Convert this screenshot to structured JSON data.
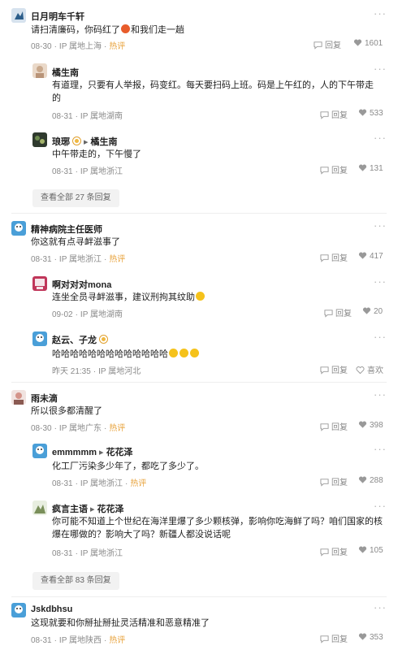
{
  "comments": [
    {
      "name": "日月明车千轩",
      "text_before": "请扫清廉码，你码红了",
      "text_after": "和我们走一趟",
      "date": "08-30",
      "ip": "IP 属地上海",
      "hot": "热评",
      "reply": "回复",
      "likes": "1601"
    },
    {
      "name": "橘生南",
      "text": "有道理，只要有人举报，码变红。每天要扫码上班。码是上午红的，人的下午带走的",
      "date": "08-31",
      "ip": "IP 属地湖南",
      "reply": "回复",
      "likes": "533"
    },
    {
      "name": "琅琊",
      "arrow": "▸",
      "reply_to": "橘生南",
      "text": "中午带走的，下午慢了",
      "date": "08-31",
      "ip": "IP 属地浙江",
      "reply": "回复",
      "likes": "131"
    },
    {
      "name": "精神病院主任医师",
      "text": "你这就有点寻衅滋事了",
      "date": "08-31",
      "ip": "IP 属地浙江",
      "hot": "热评",
      "reply": "回复",
      "likes": "417"
    },
    {
      "name": "啊对对对mona",
      "text": "连坐全员寻衅滋事，建议刑拘其纹助",
      "date": "09-02",
      "ip": "IP 属地湖南",
      "reply": "回复",
      "likes": "20"
    },
    {
      "name": "赵云、子龙",
      "text": "哈哈哈哈哈哈哈哈哈哈哈哈哈",
      "date": "昨天 21:35",
      "ip": "IP 属地河北",
      "reply": "回复",
      "likes": "喜欢"
    },
    {
      "name": "雨未滴",
      "text": "所以很多都清醒了",
      "date": "08-30",
      "ip": "IP 属地广东",
      "hot": "热评",
      "reply": "回复",
      "likes": "398"
    },
    {
      "name": "emmmmm",
      "arrow": "▸",
      "reply_to": "花花泽",
      "text": "化工厂污染多少年了，都吃了多少了。",
      "date": "08-31",
      "ip": "IP 属地浙江",
      "hot": "热评",
      "reply": "回复",
      "likes": "288"
    },
    {
      "name": "疯言主语",
      "arrow": "▸",
      "reply_to": "花花泽",
      "text": "你可能不知道上个世纪在海洋里爆了多少颗核弹，影响你吃海鲜了吗？咱们国家的核爆在哪做的？影响大了吗？新疆人都没说话呢",
      "date": "08-31",
      "ip": "IP 属地浙江",
      "reply": "回复",
      "likes": "105"
    },
    {
      "name": "Jskdbhsu",
      "text": "这现就要和你掰扯掰扯灵活精准和恶意精准了",
      "date": "08-31",
      "ip": "IP 属地陕西",
      "hot": "热评",
      "reply": "回复",
      "likes": "353"
    }
  ],
  "view_all": [
    "查看全部 27 条回复",
    "查看全部 83 条回复"
  ],
  "more_glyph": "···"
}
